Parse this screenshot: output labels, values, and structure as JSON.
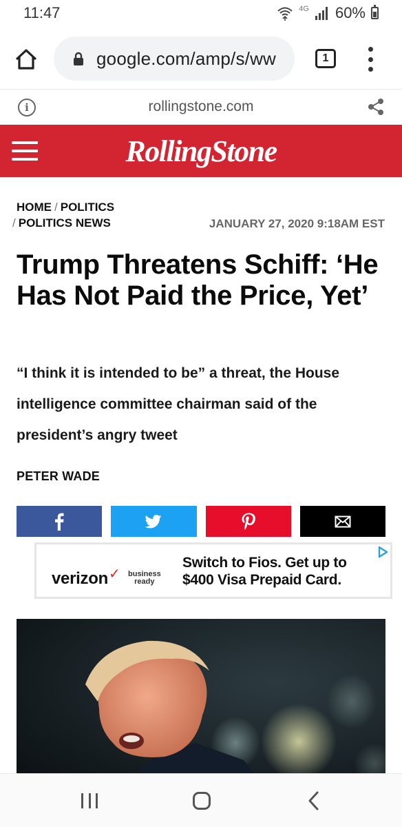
{
  "status_bar": {
    "time": "11:47",
    "network": "4G",
    "battery": "60%",
    "icons": [
      "wifi-calling-icon",
      "signal-icon",
      "battery-icon"
    ]
  },
  "browser": {
    "url": "google.com/amp/s/ww",
    "tab_count": "1",
    "icons": [
      "home-icon",
      "lock-icon",
      "tabs-icon",
      "more-icon"
    ]
  },
  "amp_header": {
    "domain": "rollingstone.com",
    "icons": [
      "info-icon",
      "share-icon"
    ]
  },
  "site": {
    "logo_text": "RollingStone",
    "brand_color": "#d32531"
  },
  "article": {
    "breadcrumb": [
      "HOME",
      "POLITICS",
      "POLITICS NEWS"
    ],
    "date": "JANUARY 27, 2020 9:18AM EST",
    "headline": "Trump Threatens Schiff: ‘He Has Not Paid the Price, Yet’",
    "dek": "“I think it is intended to be” a threat, the House intelligence committee chairman said of the president’s angry tweet",
    "author": "PETER WADE"
  },
  "share_buttons": [
    {
      "name": "facebook",
      "icon": "facebook-icon",
      "color": "#3a589b"
    },
    {
      "name": "twitter",
      "icon": "twitter-icon",
      "color": "#1da1f2"
    },
    {
      "name": "pinterest",
      "icon": "pinterest-icon",
      "color": "#e60e2a"
    },
    {
      "name": "email",
      "icon": "email-icon",
      "color": "#000000"
    }
  ],
  "ad": {
    "brand": "verizon",
    "sub_line1": "business",
    "sub_line2": "ready",
    "text_line1": "Switch to Fios. Get up to",
    "text_line2": "$400 Visa Prepaid Card."
  },
  "nav_bar": {
    "icons": [
      "recents-icon",
      "home-icon",
      "back-icon"
    ]
  }
}
